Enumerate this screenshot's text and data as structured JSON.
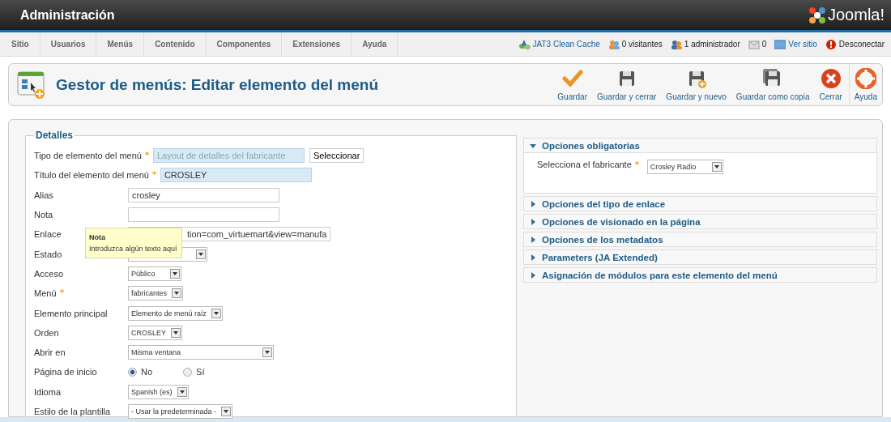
{
  "header": {
    "title": "Administración",
    "logo": "Joomla!"
  },
  "menu": [
    {
      "label": "Sitio"
    },
    {
      "label": "Usuarios"
    },
    {
      "label": "Menús"
    },
    {
      "label": "Contenido"
    },
    {
      "label": "Componentes"
    },
    {
      "label": "Extensiones"
    },
    {
      "label": "Ayuda"
    }
  ],
  "status": [
    {
      "kind": "cache",
      "label": "JAT3 Clean Cache",
      "link": true
    },
    {
      "kind": "visitors",
      "label": "0 visitantes",
      "link": false
    },
    {
      "kind": "admins",
      "label": "1 administrador",
      "link": false
    },
    {
      "kind": "messages",
      "label": "0",
      "link": false
    },
    {
      "kind": "site",
      "label": "Ver sitio",
      "link": true
    },
    {
      "kind": "logout",
      "label": "Desconectar",
      "link": false
    }
  ],
  "page_title": "Gestor de menús: Editar elemento del menú",
  "toolbar": [
    {
      "kind": "save",
      "label": "Guardar"
    },
    {
      "kind": "save-close",
      "label": "Guardar y cerrar"
    },
    {
      "kind": "save-new",
      "label": "Guardar y nuevo"
    },
    {
      "kind": "save-copy",
      "label": "Guardar como copia"
    },
    {
      "kind": "close",
      "label": "Cerrar"
    },
    {
      "kind": "help",
      "label": "Ayuda"
    }
  ],
  "details": {
    "legend": "Detalles",
    "fields": [
      {
        "label": "Tipo de elemento del menú",
        "required": true,
        "kind": "readonly",
        "value": "Layout de detalles del fabricante",
        "button": "Seleccionar"
      },
      {
        "label": "Título del elemento del menú",
        "required": true,
        "kind": "text",
        "highlighted": true,
        "value": "CROSLEY"
      },
      {
        "label": "Alias",
        "required": false,
        "kind": "text",
        "highlighted": false,
        "value": "crosley"
      },
      {
        "label": "Nota",
        "required": false,
        "kind": "text",
        "highlighted": false
      },
      {
        "label": "Enlace",
        "required": false,
        "kind": "link",
        "value": "tion=com_virtuemart&view=manufa"
      },
      {
        "label": "Estado",
        "required": false,
        "kind": "select",
        "wide": false
      },
      {
        "label": "Acceso",
        "required": false,
        "kind": "select",
        "value": "Público",
        "wide": false
      },
      {
        "label": "Menú",
        "required": true,
        "kind": "select",
        "value": "fabricantes",
        "wide": false
      },
      {
        "label": "Elemento principal",
        "required": false,
        "kind": "select",
        "value": "Elemento de menú raíz",
        "wide": false
      },
      {
        "label": "Orden",
        "required": false,
        "kind": "select",
        "value": "CROSLEY",
        "wide": false
      },
      {
        "label": "Abrir en",
        "required": false,
        "kind": "select",
        "value": "Misma ventana",
        "wide": true
      },
      {
        "label": "Página de inicio",
        "required": false,
        "kind": "radio",
        "options": [
          {
            "label": "No",
            "selected": true
          },
          {
            "label": "Sí",
            "selected": false
          }
        ]
      },
      {
        "label": "Idioma",
        "required": false,
        "kind": "select",
        "value": "Spanish (es)",
        "wide": false
      },
      {
        "label": "Estilo de la plantilla",
        "required": false,
        "kind": "select",
        "value": "- Usar la predeterminada -",
        "wide": false
      }
    ]
  },
  "tooltip": {
    "title": "Nota",
    "text": "Introduzca algún texto aquí"
  },
  "panels": [
    {
      "title": "Opciones obligatorias",
      "expanded": true,
      "field": {
        "label": "Selecciona el fabricante",
        "required": true,
        "value": "Crosley Radio"
      }
    },
    {
      "title": "Opciones del tipo de enlace",
      "expanded": false
    },
    {
      "title": "Opciones de visionado en la página",
      "expanded": false
    },
    {
      "title": "Opciones de los metadatos",
      "expanded": false
    },
    {
      "title": "Parameters (JA Extended)",
      "expanded": false
    },
    {
      "title": "Asignación de módulos para este elemento del menú",
      "expanded": false
    }
  ]
}
